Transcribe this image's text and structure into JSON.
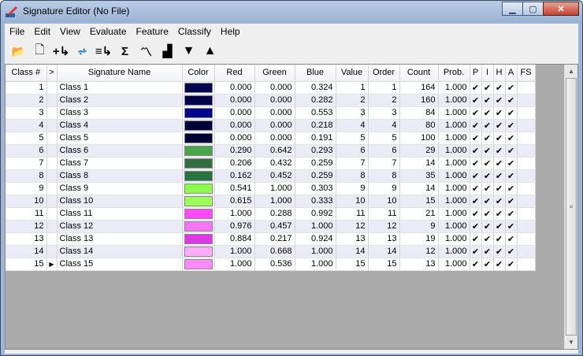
{
  "window": {
    "title": "Signature Editor (No File)"
  },
  "menu": [
    "File",
    "Edit",
    "View",
    "Evaluate",
    "Feature",
    "Classify",
    "Help"
  ],
  "toolbar": [
    {
      "name": "open-folder-icon",
      "glyph": "📂"
    },
    {
      "name": "new-file-icon",
      "glyph": "🗋"
    },
    {
      "name": "add-signature-icon",
      "glyph": "+↳"
    },
    {
      "name": "merge-icon",
      "glyph": "⩫"
    },
    {
      "name": "append-icon",
      "glyph": "≡↳"
    },
    {
      "name": "statistics-icon",
      "glyph": "Σ"
    },
    {
      "name": "mean-plot-icon",
      "glyph": "〽"
    },
    {
      "name": "histogram-icon",
      "glyph": "▟"
    },
    {
      "name": "sort-down-icon",
      "glyph": "▼"
    },
    {
      "name": "sort-up-icon",
      "glyph": "▲"
    }
  ],
  "columns": [
    "Class #",
    ">",
    "Signature Name",
    "Color",
    "Red",
    "Green",
    "Blue",
    "Value",
    "Order",
    "Count",
    "Prob.",
    "P",
    "I",
    "H",
    "A",
    "FS"
  ],
  "check_glyph": "✔",
  "rows": [
    {
      "num": "1",
      "ptr": "",
      "name": "Class 1",
      "color": "#000050",
      "red": "0.000",
      "green": "0.000",
      "blue": "0.324",
      "value": "1",
      "order": "1",
      "count": "164",
      "prob": "1.000"
    },
    {
      "num": "2",
      "ptr": "",
      "name": "Class 2",
      "color": "#000048",
      "red": "0.000",
      "green": "0.000",
      "blue": "0.282",
      "value": "2",
      "order": "2",
      "count": "160",
      "prob": "1.000"
    },
    {
      "num": "3",
      "ptr": "",
      "name": "Class 3",
      "color": "#00008d",
      "red": "0.000",
      "green": "0.000",
      "blue": "0.553",
      "value": "3",
      "order": "3",
      "count": "84",
      "prob": "1.000"
    },
    {
      "num": "4",
      "ptr": "",
      "name": "Class 4",
      "color": "#000038",
      "red": "0.000",
      "green": "0.000",
      "blue": "0.218",
      "value": "4",
      "order": "4",
      "count": "80",
      "prob": "1.000"
    },
    {
      "num": "5",
      "ptr": "",
      "name": "Class 5",
      "color": "#000031",
      "red": "0.000",
      "green": "0.000",
      "blue": "0.191",
      "value": "5",
      "order": "5",
      "count": "100",
      "prob": "1.000"
    },
    {
      "num": "6",
      "ptr": "",
      "name": "Class 6",
      "color": "#4aa44b",
      "red": "0.290",
      "green": "0.642",
      "blue": "0.293",
      "value": "6",
      "order": "6",
      "count": "29",
      "prob": "1.000"
    },
    {
      "num": "7",
      "ptr": "",
      "name": "Class 7",
      "color": "#346e42",
      "red": "0.206",
      "green": "0.432",
      "blue": "0.259",
      "value": "7",
      "order": "7",
      "count": "14",
      "prob": "1.000"
    },
    {
      "num": "8",
      "ptr": "",
      "name": "Class 8",
      "color": "#297342",
      "red": "0.162",
      "green": "0.452",
      "blue": "0.259",
      "value": "8",
      "order": "8",
      "count": "35",
      "prob": "1.000"
    },
    {
      "num": "9",
      "ptr": "",
      "name": "Class 9",
      "color": "#8aff4d",
      "red": "0.541",
      "green": "1.000",
      "blue": "0.303",
      "value": "9",
      "order": "9",
      "count": "14",
      "prob": "1.000"
    },
    {
      "num": "10",
      "ptr": "",
      "name": "Class 10",
      "color": "#9dff55",
      "red": "0.615",
      "green": "1.000",
      "blue": "0.333",
      "value": "10",
      "order": "10",
      "count": "15",
      "prob": "1.000"
    },
    {
      "num": "11",
      "ptr": "",
      "name": "Class 11",
      "color": "#ff49fd",
      "red": "1.000",
      "green": "0.288",
      "blue": "0.992",
      "value": "11",
      "order": "11",
      "count": "21",
      "prob": "1.000"
    },
    {
      "num": "12",
      "ptr": "",
      "name": "Class 12",
      "color": "#f974ff",
      "red": "0.976",
      "green": "0.457",
      "blue": "1.000",
      "value": "12",
      "order": "12",
      "count": "9",
      "prob": "1.000"
    },
    {
      "num": "13",
      "ptr": "",
      "name": "Class 13",
      "color": "#e137eb",
      "red": "0.884",
      "green": "0.217",
      "blue": "0.924",
      "value": "13",
      "order": "13",
      "count": "19",
      "prob": "1.000"
    },
    {
      "num": "14",
      "ptr": "",
      "name": "Class 14",
      "color": "#ffaaff",
      "red": "1.000",
      "green": "0.668",
      "blue": "1.000",
      "value": "14",
      "order": "14",
      "count": "12",
      "prob": "1.000"
    },
    {
      "num": "15",
      "ptr": "▶",
      "name": "Class 15",
      "color": "#ff89ff",
      "red": "1.000",
      "green": "0.536",
      "blue": "1.000",
      "value": "15",
      "order": "15",
      "count": "13",
      "prob": "1.000"
    }
  ],
  "colors": {
    "title_bar": "#9db6d6",
    "alt_row": "#ececf9",
    "grid_bg": "#ababab"
  }
}
